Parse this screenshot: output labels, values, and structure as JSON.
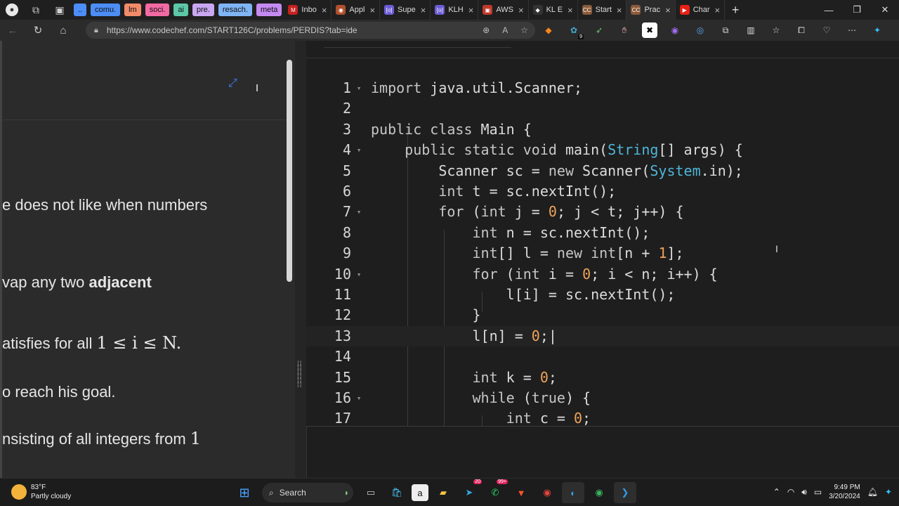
{
  "browser": {
    "tab_groups": [
      {
        "label": "..",
        "color": "#4c8df6"
      },
      {
        "label": "comu.",
        "color": "#4c8df6"
      },
      {
        "label": "lm",
        "color": "#f28b6a"
      },
      {
        "label": "soci.",
        "color": "#f26aa4"
      },
      {
        "label": "ai",
        "color": "#5dc8a8"
      },
      {
        "label": "pre.",
        "color": "#c9a7f2"
      },
      {
        "label": "resach.",
        "color": "#7fb4f5"
      },
      {
        "label": "meta",
        "color": "#c58af2"
      }
    ],
    "tabs": [
      {
        "label": "Inbo",
        "fav": "M",
        "fav_color": "#c5221f"
      },
      {
        "label": "Appl",
        "fav": "◉",
        "fav_color": "#b0502c"
      },
      {
        "label": "Supe",
        "fav": "[o]",
        "fav_color": "#6b5bd6"
      },
      {
        "label": "KLH",
        "fav": "[o]",
        "fav_color": "#6b5bd6"
      },
      {
        "label": "AWS",
        "fav": "▣",
        "fav_color": "#c0392b"
      },
      {
        "label": "KL E",
        "fav": "◆",
        "fav_color": "#333333"
      },
      {
        "label": "Start",
        "fav": "CC",
        "fav_color": "#8a5a3b"
      },
      {
        "label": "Prac",
        "fav": "CC",
        "fav_color": "#8a5a3b",
        "active": true
      },
      {
        "label": "Char",
        "fav": "▶",
        "fav_color": "#e62117"
      }
    ],
    "url": "https://www.codechef.com/START126C/problems/PERDIS?tab=ide"
  },
  "problem": {
    "line1": "e does not like when numbers",
    "line2_pre": "vap any two ",
    "line2_bold": "adjacent",
    "line3_pre": "atisfies for all ",
    "line3_math": "1 ≤ i ≤ N.",
    "line4": "o reach his goal.",
    "line5_pre": "nsisting of all integers from ",
    "line5_math": "1"
  },
  "code_lines": [
    {
      "n": "1",
      "fold": true
    },
    {
      "n": "2"
    },
    {
      "n": "3"
    },
    {
      "n": "4",
      "fold": true
    },
    {
      "n": "5"
    },
    {
      "n": "6"
    },
    {
      "n": "7",
      "fold": true
    },
    {
      "n": "8"
    },
    {
      "n": "9"
    },
    {
      "n": "10",
      "fold": true
    },
    {
      "n": "11"
    },
    {
      "n": "12"
    },
    {
      "n": "13",
      "current": true
    },
    {
      "n": "14"
    },
    {
      "n": "15"
    },
    {
      "n": "16",
      "fold": true
    },
    {
      "n": "17"
    }
  ],
  "code_text": {
    "l1_a": "import",
    "l1_b": " java.util.Scanner;",
    "l3_a": "public class",
    "l3_b": " Main {",
    "l4_a": "    public static void",
    "l4_b": " main(",
    "l4_c": "String",
    "l4_d": "[] args) {",
    "l5_a": "        Scanner sc = ",
    "l5_b": "new",
    "l5_c": " Scanner(",
    "l5_d": "System",
    "l5_e": ".in);",
    "l6_a": "        int",
    "l6_b": " t = sc.nextInt();",
    "l7_a": "        for",
    "l7_b": " (",
    "l7_c": "int",
    "l7_d": " j = ",
    "l7_e": "0",
    "l7_f": "; j < t; j++) {",
    "l8_a": "            int",
    "l8_b": " n = sc.nextInt();",
    "l9_a": "            int",
    "l9_b": "[] l = ",
    "l9_c": "new",
    "l9_d": " ",
    "l9_e": "int",
    "l9_f": "[n + ",
    "l9_g": "1",
    "l9_h": "];",
    "l10_a": "            for",
    "l10_b": " (",
    "l10_c": "int",
    "l10_d": " i = ",
    "l10_e": "0",
    "l10_f": "; i < n; i++) {",
    "l11_a": "                l[i] = sc.nextInt();",
    "l12_a": "            }",
    "l13_a": "            l[n] = ",
    "l13_b": "0",
    "l13_c": ";",
    "l15_a": "            int",
    "l15_b": " k = ",
    "l15_c": "0",
    "l15_d": ";",
    "l16_a": "            while",
    "l16_b": " (",
    "l16_c": "true",
    "l16_d": ") {",
    "l17_a": "                int",
    "l17_b": " c = ",
    "l17_c": "0",
    "l17_d": ";"
  },
  "taskbar": {
    "temp": "83°F",
    "weather": "Partly cloudy",
    "search": "Search",
    "time": "9:49 PM",
    "date": "3/20/2024",
    "whatsapp_badge": "99+",
    "telegram_badge": "20"
  },
  "ext_badge": "9"
}
